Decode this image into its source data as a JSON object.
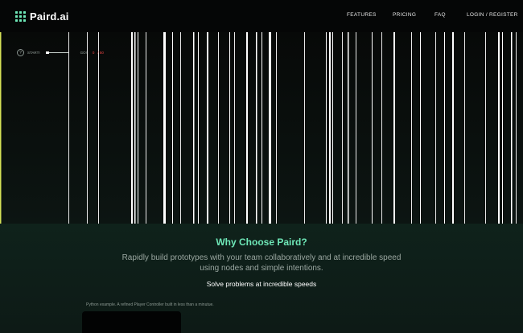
{
  "nav": {
    "brand": "Paird.ai",
    "links": [
      "FEATURES",
      "PRICING",
      "FAQ",
      "LOGIN / REGISTER"
    ]
  },
  "game": {
    "help_glyph": "?",
    "start_label": "START!",
    "goal_label": "GO!",
    "score": "0",
    "score_total": "/ 50"
  },
  "features": {
    "heading": "Why Choose Paird?",
    "description": "Rapidly build prototypes with your team collaboratively and at incredible speed using nodes and simple intentions.",
    "subheading": "Solve problems at incredible speeds",
    "caption": "Python example. A refined Player Controller built in less than a minutue."
  },
  "colors": {
    "accent": "#6ee7b7",
    "score_red": "#ef4444",
    "background": "#0a0d0c"
  }
}
